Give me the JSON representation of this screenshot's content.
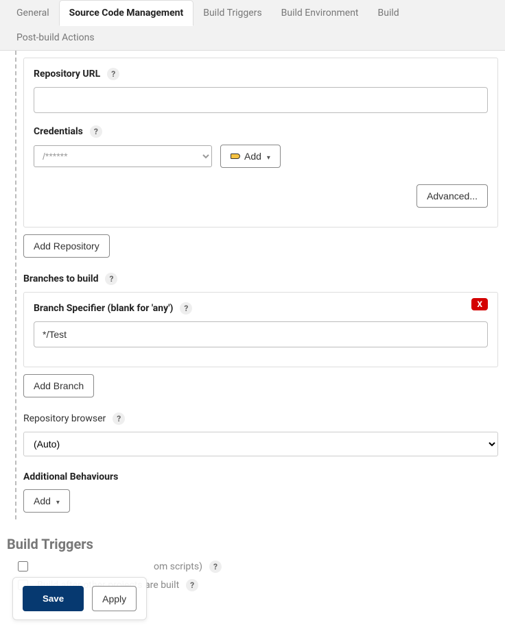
{
  "tabs": {
    "general": "General",
    "scm": "Source Code Management",
    "triggers": "Build Triggers",
    "env": "Build Environment",
    "build": "Build",
    "post": "Post-build Actions"
  },
  "scm": {
    "repo_url_label": "Repository URL",
    "repo_url_value": "                                                                         ",
    "credentials_label": "Credentials",
    "credentials_value": "           /******",
    "add_btn": "Add",
    "advanced_btn": "Advanced...",
    "add_repo_btn": "Add Repository",
    "branches_label": "Branches to build",
    "branch_specifier_label": "Branch Specifier (blank for 'any')",
    "branch_specifier_value": "*/Test",
    "delete_x": "X",
    "add_branch_btn": "Add Branch",
    "repo_browser_label": "Repository browser",
    "repo_browser_value": "(Auto)",
    "additional_behaviours_label": "Additional Behaviours",
    "add_behaviour_btn": "Add"
  },
  "triggers": {
    "heading": "Build Triggers",
    "remote_label": "om scripts)",
    "after_label": "Build after other projects are built"
  },
  "save_bar": {
    "save": "Save",
    "apply": "Apply"
  },
  "help_glyph": "?"
}
